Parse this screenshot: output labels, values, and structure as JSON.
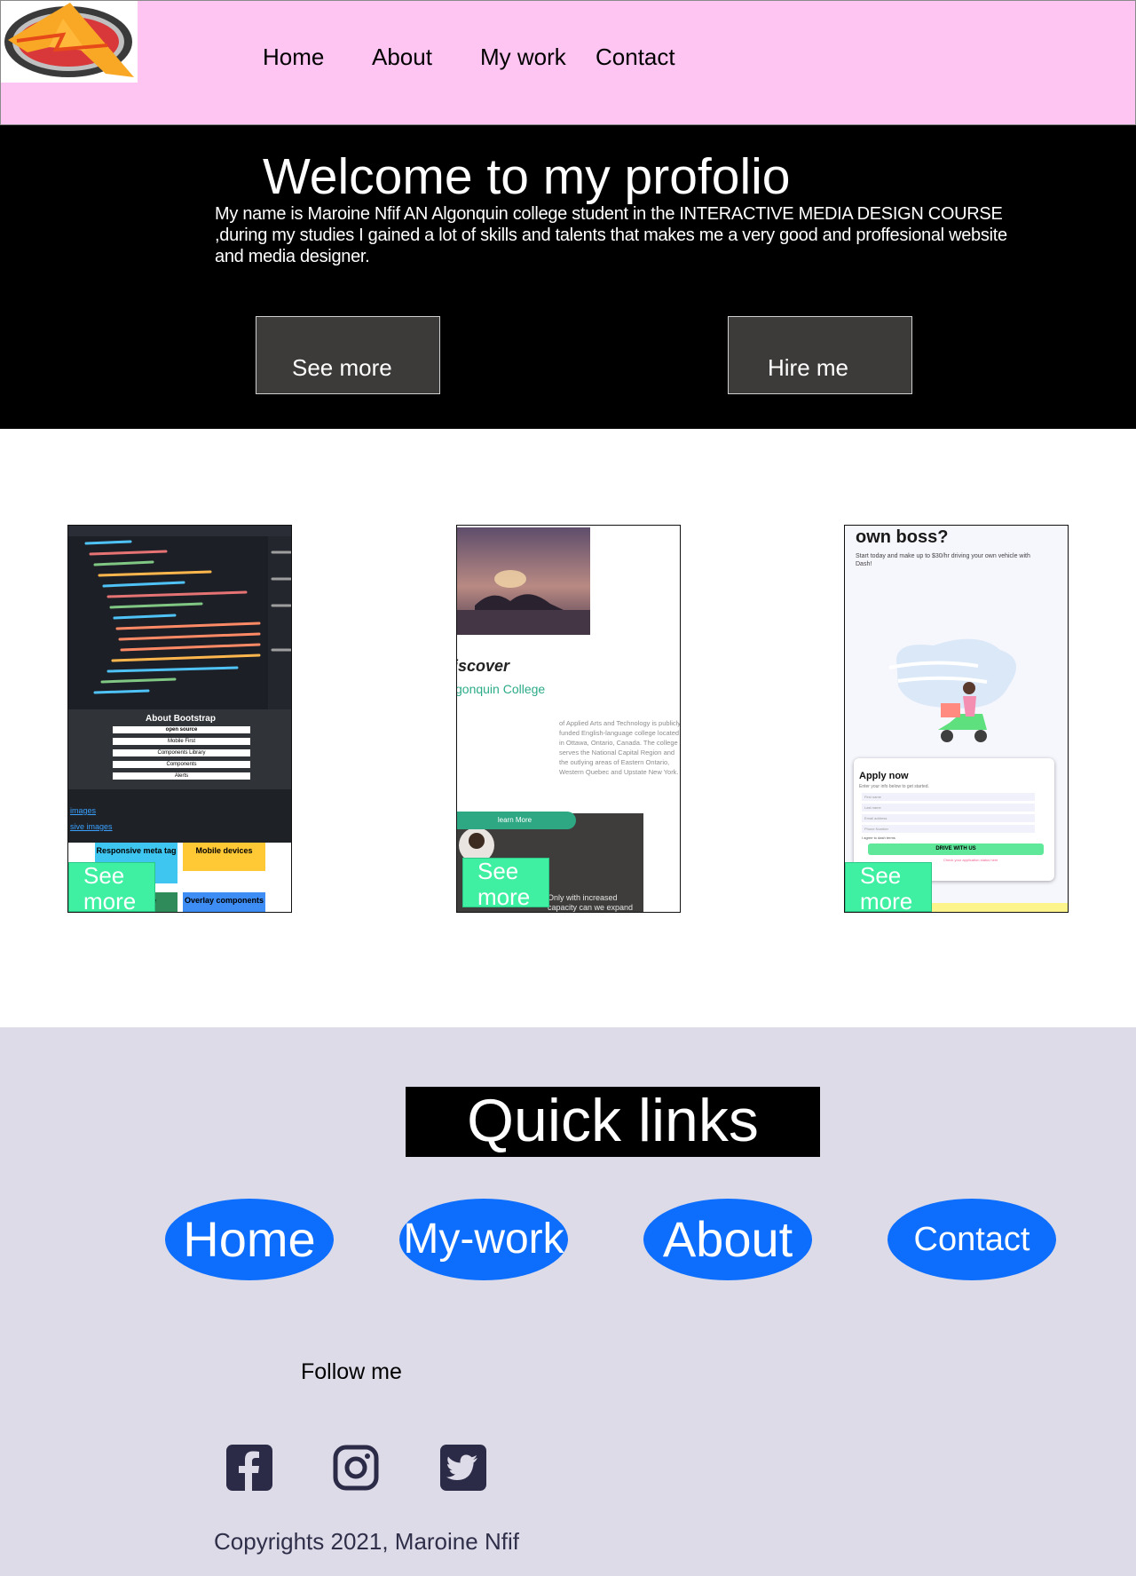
{
  "colors": {
    "header_bg": "#fec5f3",
    "hero_bg": "#000000",
    "button_bg": "#3d3b3a",
    "see_more_bg": "#3ff0a3",
    "footer_bg": "#dddbe8",
    "pill_bg": "#0d6efd",
    "icon_color": "#2c2b47"
  },
  "nav": {
    "items": [
      {
        "label": "Home"
      },
      {
        "label": "About"
      },
      {
        "label": "My work"
      },
      {
        "label": "Contact"
      }
    ]
  },
  "hero": {
    "title": "Welcome to my profolio",
    "intro": "My name is Maroine Nfif AN Algonquin college student in the INTERACTIVE MEDIA DESIGN COURSE ,during my studies I gained a lot of skills and talents that makes me a very good and proffesional website and media designer.",
    "see_more_label": "See more",
    "hire_me_label": "Hire me"
  },
  "cards": [
    {
      "see_more_label": "See\nmore",
      "thumb": {
        "banner": "About Bootstrap",
        "items": [
          "open source",
          "Mobile First",
          "Components Library",
          "Components",
          "Alerts"
        ],
        "links": [
          "images",
          "sive images"
        ],
        "tiles": [
          "Responsive meta tag",
          "Mobile devices",
          "e",
          "Overlay components"
        ]
      }
    },
    {
      "see_more_label": "See\nmore",
      "thumb": {
        "heading": "iscover",
        "subheading": "gonquin College",
        "body": "of Applied Arts and Technology is publicly funded English-language college located in Ottawa, Ontario, Canada. The college serves the National Capital Region and the outlying areas of Eastern Ontario, Western Quebec and Upstate New York.",
        "button": "learn More",
        "footer_text": "Only with increased capacity can we expand"
      }
    },
    {
      "see_more_label": "See\nmore",
      "thumb": {
        "heading": "own boss?",
        "subheading": "Start today and make up to $30/hr driving your own vehicle with Dash!",
        "form_title": "Apply now",
        "form_hint": "Enter your info below to get started.",
        "fields": [
          "First name",
          "Last name",
          "Email address",
          "Phone Number"
        ],
        "checkbox": "I agree to dash terms",
        "button": "DRIVE WITH US",
        "status": "Check your application status here"
      }
    }
  ],
  "footer": {
    "quick_links_title": "Quick links",
    "links": [
      {
        "label": "Home"
      },
      {
        "label": "My-work"
      },
      {
        "label": "About"
      },
      {
        "label": "Contact"
      }
    ],
    "follow_label": "Follow me",
    "social_icons": [
      "facebook-icon",
      "instagram-icon",
      "twitter-icon"
    ],
    "copyright": "Copyrights 2021, Maroine Nfif"
  }
}
